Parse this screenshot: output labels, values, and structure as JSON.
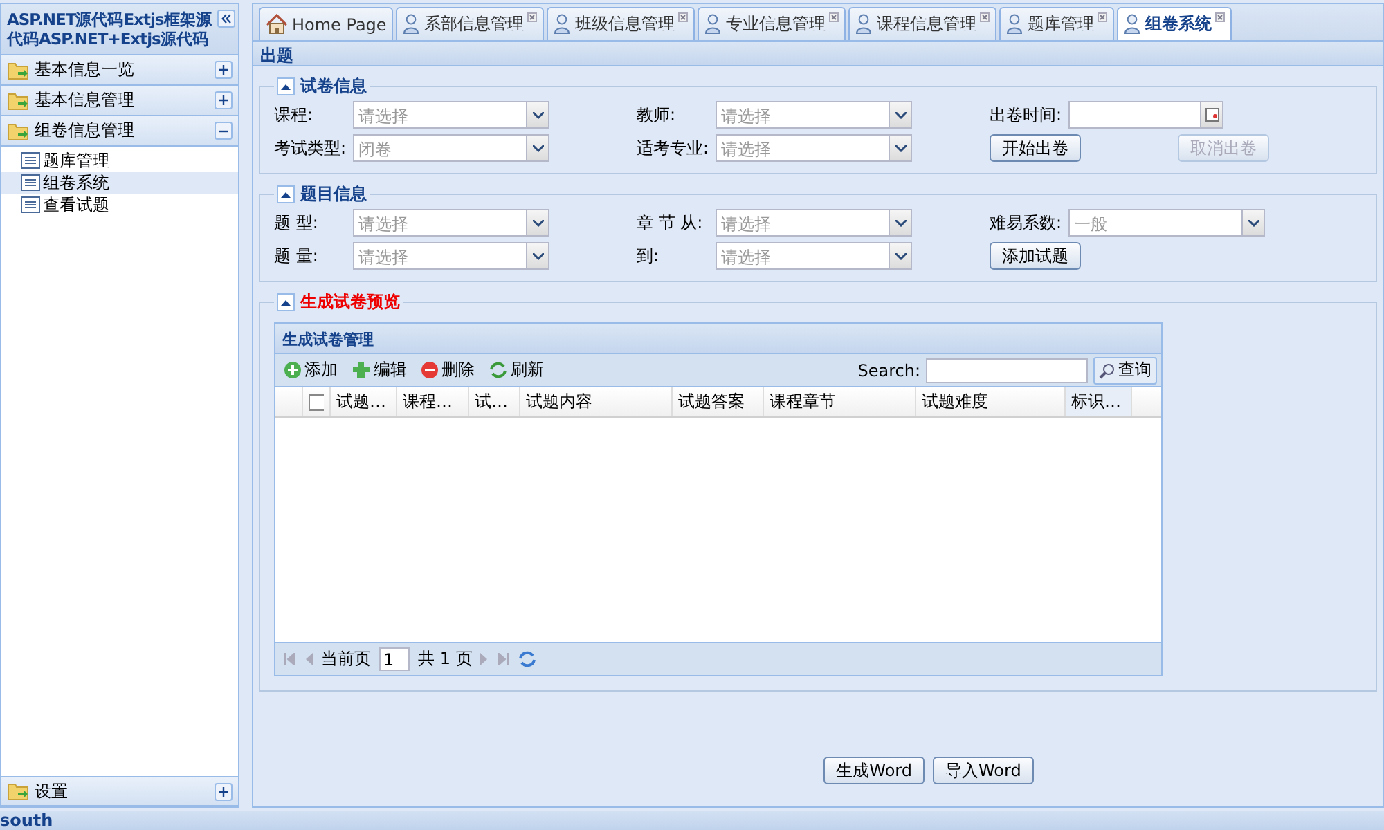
{
  "sidebar": {
    "title": "ASP.NET源代码Extjs框架源代码ASP.NET+Extjs源代码",
    "groups": [
      {
        "label": "基本信息一览",
        "expanded": false
      },
      {
        "label": "基本信息管理",
        "expanded": false
      },
      {
        "label": "组卷信息管理",
        "expanded": true,
        "items": [
          {
            "label": "题库管理",
            "selected": false
          },
          {
            "label": "组卷系统",
            "selected": true
          },
          {
            "label": "查看试题",
            "selected": false
          }
        ]
      }
    ],
    "bottom_group": {
      "label": "设置",
      "expanded": false
    }
  },
  "tabs": [
    {
      "label": "Home Page",
      "kind": "home",
      "selected": false
    },
    {
      "label": "系部信息管理",
      "kind": "user",
      "selected": false
    },
    {
      "label": "班级信息管理",
      "kind": "user",
      "selected": false
    },
    {
      "label": "专业信息管理",
      "kind": "user",
      "selected": false
    },
    {
      "label": "课程信息管理",
      "kind": "user",
      "selected": false
    },
    {
      "label": "题库管理",
      "kind": "user",
      "selected": false
    },
    {
      "label": "组卷系统",
      "kind": "user",
      "selected": true
    }
  ],
  "panel": {
    "title": "出题",
    "fieldsets": [
      {
        "legend": "试卷信息",
        "expanded": true,
        "highlight": false,
        "cells": [
          {
            "kind": "select",
            "label": "课程:",
            "placeholder": "请选择"
          },
          {
            "kind": "select",
            "label": "教师:",
            "placeholder": "请选择"
          },
          {
            "kind": "date",
            "label": "出卷时间:"
          },
          {
            "kind": "select",
            "label": "考试类型:",
            "placeholder": "闭卷"
          },
          {
            "kind": "select",
            "label": "适考专业:",
            "placeholder": "请选择"
          },
          {
            "kind": "buttons",
            "buttons": [
              {
                "label": "开始出卷",
                "disabled": false
              },
              {
                "label": "取消出卷",
                "disabled": true
              }
            ]
          }
        ]
      },
      {
        "legend": "题目信息",
        "expanded": true,
        "highlight": false,
        "cells": [
          {
            "kind": "select",
            "label": "题 型:",
            "placeholder": "请选择"
          },
          {
            "kind": "select",
            "label": "章 节 从:",
            "placeholder": "请选择"
          },
          {
            "kind": "select",
            "label": "难易系数:",
            "placeholder": "一般"
          },
          {
            "kind": "select",
            "label": "题 量:",
            "placeholder": "请选择"
          },
          {
            "kind": "select",
            "label": "到:",
            "placeholder": "请选择"
          },
          {
            "kind": "buttons",
            "buttons": [
              {
                "label": "添加试题",
                "disabled": false
              }
            ]
          }
        ]
      }
    ],
    "preview": {
      "legend": "生成试卷预览",
      "expanded": true,
      "highlight": true,
      "grid": {
        "title": "生成试卷管理",
        "toolbar": [
          {
            "label": "添加",
            "kind": "add"
          },
          {
            "label": "编辑",
            "kind": "edit"
          },
          {
            "label": "删除",
            "kind": "delete"
          },
          {
            "label": "刷新",
            "kind": "refresh"
          }
        ],
        "search_label": "Search:",
        "search_button": "查询",
        "select_all": false,
        "columns": [
          "试题…",
          "课程…",
          "试…",
          "试题内容",
          "试题答案",
          "课程章节",
          "试题难度",
          "标识…"
        ],
        "paging": {
          "before": "当前页",
          "page": "1",
          "after": "共 1 页"
        }
      }
    },
    "buttons": [
      "生成Word",
      "导入Word"
    ]
  },
  "south": "south"
}
